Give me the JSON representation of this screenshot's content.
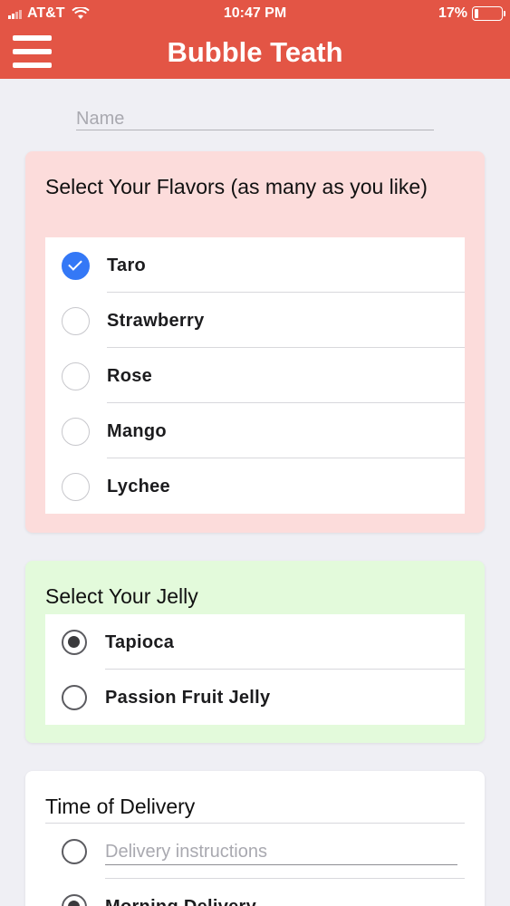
{
  "status_bar": {
    "carrier": "AT&T",
    "time": "10:47 PM",
    "battery": "17%"
  },
  "nav": {
    "title": "Bubble Teath",
    "menu_icon": "hamburger-menu-icon"
  },
  "name_field": {
    "placeholder": "Name",
    "value": ""
  },
  "flavors": {
    "title": "Select Your Flavors (as many as you like)",
    "background": "#fcdcdb",
    "options": [
      {
        "label": "Taro",
        "checked": true
      },
      {
        "label": "Strawberry",
        "checked": false
      },
      {
        "label": "Rose",
        "checked": false
      },
      {
        "label": "Mango",
        "checked": false
      },
      {
        "label": "Lychee",
        "checked": false
      }
    ]
  },
  "jelly": {
    "title": "Select Your Jelly",
    "background": "#e3fadb",
    "options": [
      {
        "label": "Tapioca",
        "selected": true
      },
      {
        "label": "Passion Fruit Jelly",
        "selected": false
      }
    ]
  },
  "delivery": {
    "title": "Time of Delivery",
    "background": "#ffffff",
    "instructions_placeholder": "Delivery instructions",
    "options": [
      {
        "label": "Morning Delivery",
        "selected": true
      }
    ]
  },
  "colors": {
    "accent": "#e35545",
    "checkbox_on": "#3478f6"
  }
}
